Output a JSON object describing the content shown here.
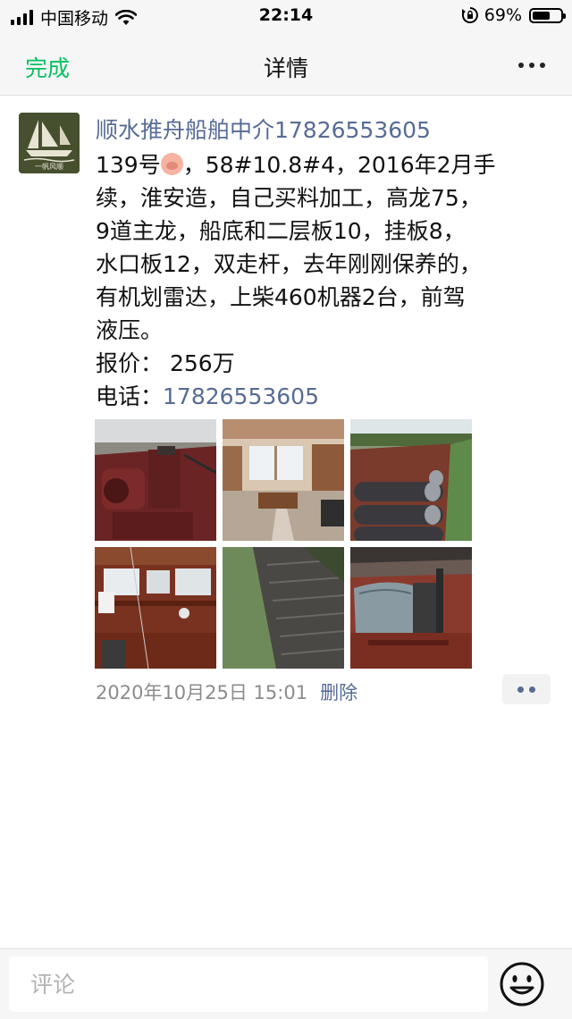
{
  "status_bar": {
    "carrier": "中国移动",
    "time": "22:14",
    "battery_percent": "69%",
    "battery_level": 0.69,
    "icons": [
      "signal-icon",
      "wifi-icon",
      "orientation-lock-icon",
      "battery-icon"
    ]
  },
  "nav": {
    "done_label": "完成",
    "title": "详情",
    "more_icon": "more-dots-icon"
  },
  "post": {
    "author": "顺水推舟船舶中介17826553605",
    "avatar_icon": "sailboat-logo-icon",
    "avatar_text": "一帆风顺",
    "body_lines": [
      "139号",
      "，58#10.8#4，2016年2月手",
      "续，淮安造，自己买料加工，高龙75，",
      "9道主龙，船底和二层板10，挂板8，",
      "水口板12，双走杆，去年刚刚保养的，",
      "有机划雷达，上柴460机器2台，前驾",
      "液压。"
    ],
    "emoji_icon": "pig-face-icon",
    "price_label": "报价：",
    "price_value": "256万",
    "phone_label": "电话：",
    "phone_value": "17826553605",
    "photos": [
      {
        "name": "photo-engine-room"
      },
      {
        "name": "photo-cabin-interior"
      },
      {
        "name": "photo-steel-rollers"
      },
      {
        "name": "photo-wheelhouse"
      },
      {
        "name": "photo-cargo-hold"
      },
      {
        "name": "photo-covered-machinery"
      }
    ],
    "timestamp": "2020年10月25日 15:01",
    "delete_label": "删除",
    "action_icon": "two-dots-icon"
  },
  "comment": {
    "placeholder": "评论",
    "emoji_icon": "smiley-icon"
  },
  "colors": {
    "accent_green": "#07c160",
    "link_blue": "#576b95",
    "meta_gray": "#8c8c8c",
    "bar_bg": "#f6f6f6"
  }
}
